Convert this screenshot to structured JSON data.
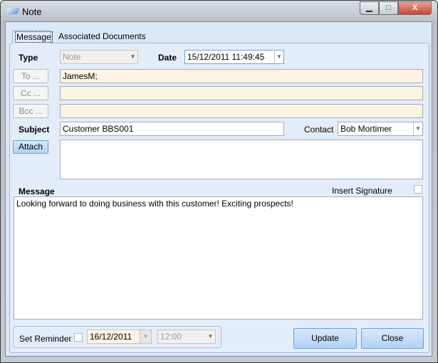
{
  "window": {
    "title": "Note"
  },
  "tabs": [
    {
      "label": "Message",
      "active": true
    },
    {
      "label": "Associated Documents",
      "active": false
    }
  ],
  "form": {
    "type_label": "Type",
    "type_value": "Note",
    "date_label": "Date",
    "date_value": "15/12/2011 11:49:45",
    "to_button": "To ...",
    "to_value": "JamesM;",
    "cc_button": "Cc ...",
    "cc_value": "",
    "bcc_button": "Bcc ...",
    "bcc_value": "",
    "subject_label": "Subject",
    "subject_value": "Customer BBS001",
    "contact_label": "Contact",
    "contact_value": "Bob Mortimer",
    "attach_button": "Attach",
    "message_label": "Message",
    "insert_signature_label": "Insert Signature",
    "insert_signature_checked": false,
    "message_value": "Looking forward to doing business with this customer! Exciting prospects!"
  },
  "reminder": {
    "label": "Set Reminder",
    "checked": false,
    "date": "16/12/2011",
    "time": "12:00"
  },
  "buttons": {
    "update": "Update",
    "close": "Close"
  }
}
